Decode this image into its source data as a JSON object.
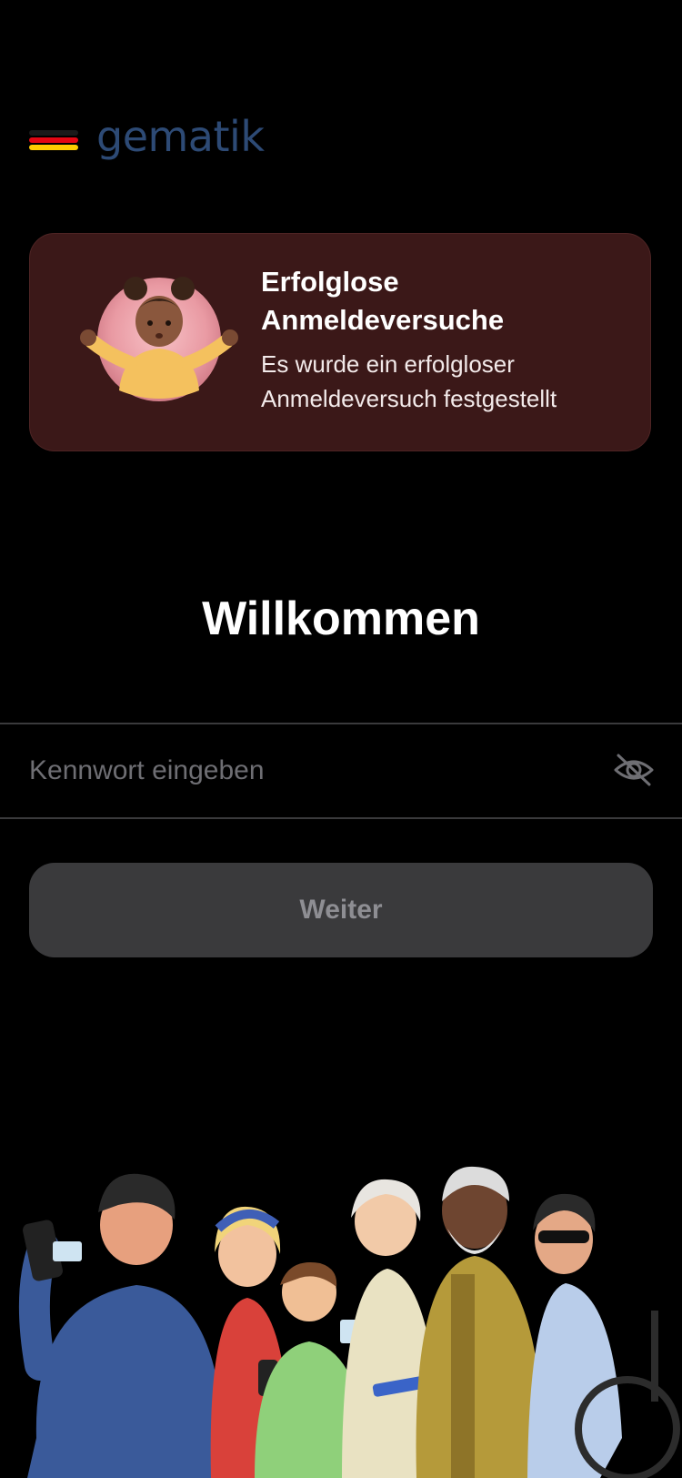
{
  "brand": {
    "name": "gematik",
    "flag_colors": [
      "#1a1a1a",
      "#e30613",
      "#ffcc00"
    ],
    "text_color": "#2d4a75"
  },
  "alert": {
    "title": "Erfolglose Anmeldeversuche",
    "body": "Es wurde ein erfolgloser Anmeldeversuch festgestellt",
    "illustration": "shrugging-girl-illustration",
    "background_color": "#3b1818"
  },
  "welcome": {
    "title": "Willkommen"
  },
  "password": {
    "placeholder": "Kennwort eingeben",
    "value": "",
    "toggle_icon": "eye-slash-icon"
  },
  "actions": {
    "continue_label": "Weiter",
    "continue_enabled": false
  },
  "footer": {
    "illustration": "group-of-people-illustration"
  },
  "colors": {
    "background": "#000000",
    "button_disabled_bg": "#3a3a3c",
    "button_disabled_text": "#8e8e93",
    "divider": "#3a3a3c"
  }
}
